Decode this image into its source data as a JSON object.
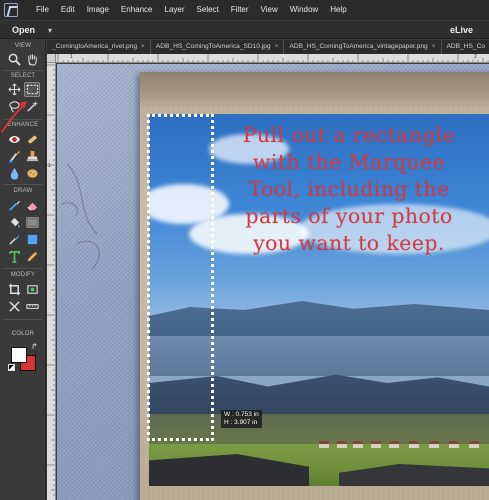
{
  "menu": {
    "items": [
      "File",
      "Edit",
      "Image",
      "Enhance",
      "Layer",
      "Select",
      "Filter",
      "View",
      "Window",
      "Help"
    ]
  },
  "topbar": {
    "open_label": "Open",
    "mode_label": "eLive"
  },
  "tabs": [
    {
      "label": "_ComingtoAmerica_rivet.png"
    },
    {
      "label": "ADB_HS_ComingToAmerica_SD10.jpg"
    },
    {
      "label": "ADB_HS_ComingToAmerica_vintagepaper.png"
    },
    {
      "label": "ADB_HS_Co"
    }
  ],
  "toolbox": {
    "sections": {
      "view": "VIEW",
      "select": "SELECT",
      "enhance": "ENHANCE",
      "draw": "DRAW",
      "modify": "MODIFY",
      "color": "COLOR"
    },
    "foreground_color": "#ffffff",
    "background_color": "#d53435",
    "active_tool": "rectangular-marquee-tool"
  },
  "ruler": {
    "top_numbers": [
      "1",
      "2"
    ],
    "left_numbers": [
      "1"
    ]
  },
  "canvas": {
    "instruction_lines": [
      "Pull out a rectangle",
      "with the Marquee",
      "Tool, including the",
      "parts of your photo",
      "you want to keep."
    ],
    "instruction_color": "#d8393f",
    "selection_width": "W : 0.753 in",
    "selection_height": "H : 3.907 in"
  }
}
